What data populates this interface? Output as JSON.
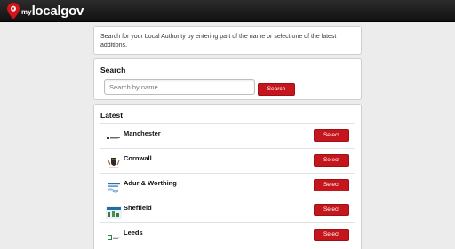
{
  "brand": {
    "my": "my",
    "local": "local",
    "gov": "gov"
  },
  "intro": {
    "text": "Search for your Local Authority by entering part of the name or select one of the latest additions."
  },
  "search": {
    "heading": "Search",
    "placeholder": "Search by name...",
    "button_label": "Search"
  },
  "latest": {
    "heading": "Latest",
    "items": [
      {
        "name": "Manchester",
        "button_label": "Select",
        "icon": "manchester-logo-icon"
      },
      {
        "name": "Cornwall",
        "button_label": "Select",
        "icon": "cornwall-crest-icon"
      },
      {
        "name": "Adur & Worthing",
        "button_label": "Select",
        "icon": "adur-worthing-logo-icon"
      },
      {
        "name": "Sheffield",
        "button_label": "Select",
        "icon": "sheffield-logo-icon"
      },
      {
        "name": "Leeds",
        "button_label": "Select",
        "icon": "leeds-logo-icon"
      }
    ]
  },
  "colors": {
    "topbar": "#1a1a1a",
    "accent": "#c4161c",
    "background": "#ececec"
  }
}
